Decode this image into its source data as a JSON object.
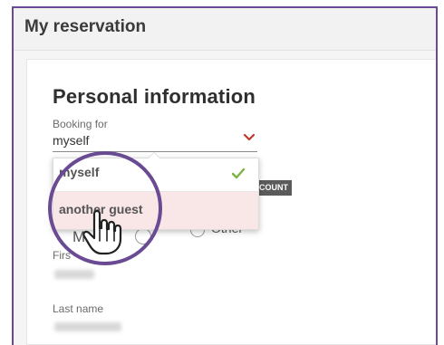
{
  "window": {
    "title": "My reservation"
  },
  "form": {
    "section_title": "Personal information",
    "booking_for": {
      "label": "Booking for",
      "value": "myself"
    },
    "dropdown": {
      "options": [
        {
          "label": "myself",
          "selected": true
        },
        {
          "label": "another guest",
          "highlighted": true
        }
      ]
    },
    "badge": "COUNT",
    "gender": {
      "m_label": "M",
      "other_label": "Other"
    },
    "first_name_label": "Firs",
    "last_name_label": "Last name"
  },
  "icons": {
    "chevron": "chevron-down-icon",
    "check": "check-icon",
    "pointer": "hand-pointer-icon"
  },
  "colors": {
    "accent": "#6a4b93",
    "chevron": "#c0392b",
    "check": "#7cb342",
    "highlight": "#f9e6e6"
  }
}
